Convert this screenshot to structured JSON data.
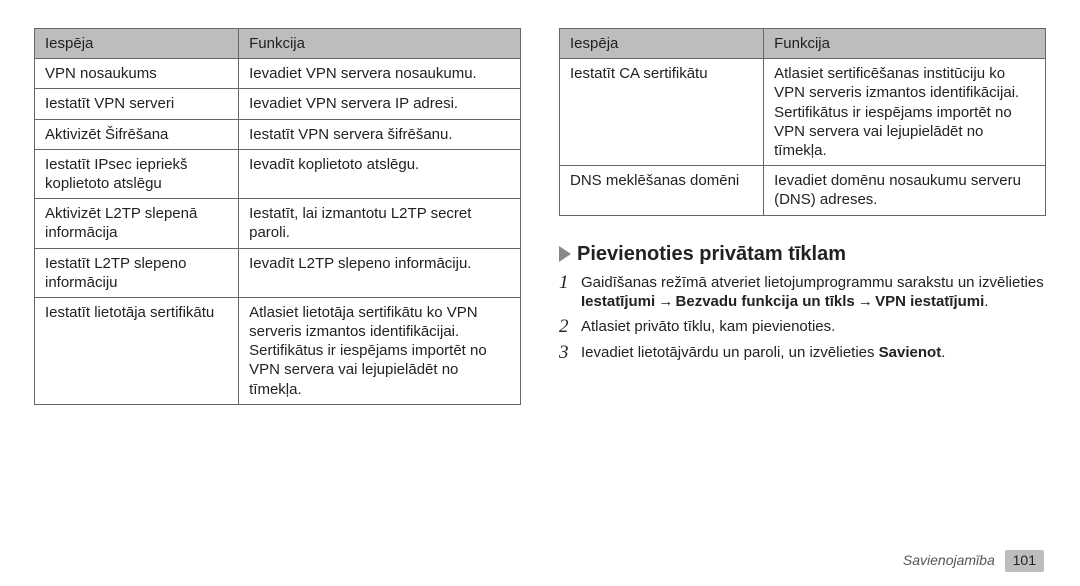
{
  "left_table": {
    "h1": "Iespēja",
    "h2": "Funkcija",
    "rows": [
      {
        "c1": "VPN nosaukums",
        "c2": "Ievadiet VPN servera nosaukumu."
      },
      {
        "c1": "Iestatīt VPN serveri",
        "c2": "Ievadiet VPN servera IP adresi."
      },
      {
        "c1": "Aktivizēt Šifrēšana",
        "c2": "Iestatīt VPN servera šifrēšanu."
      },
      {
        "c1": "Iestatīt IPsec iepriekš koplietoto atslēgu",
        "c2": "Ievadīt koplietoto atslēgu."
      },
      {
        "c1": "Aktivizēt L2TP slepenā informācija",
        "c2": "Iestatīt, lai izmantotu L2TP secret paroli."
      },
      {
        "c1": "Iestatīt L2TP slepeno informāciju",
        "c2": "Ievadīt L2TP slepeno informāciju."
      },
      {
        "c1": "Iestatīt lietotāja sertifikātu",
        "c2": "Atlasiet lietotāja sertifikātu ko VPN serveris izmantos identifikācijai. Sertifikātus ir iespējams importēt no VPN servera vai lejupielādēt no tīmekļa."
      }
    ]
  },
  "right_table": {
    "h1": "Iespēja",
    "h2": "Funkcija",
    "rows": [
      {
        "c1": "Iestatīt CA sertifikātu",
        "c2": "Atlasiet sertificēšanas institūciju ko VPN serveris izmantos identifikācijai. Sertifikātus ir iespējams importēt no VPN servera vai lejupielādēt no tīmekļa."
      },
      {
        "c1": "DNS meklēšanas domēni",
        "c2": "Ievadiet domēnu nosaukumu serveru (DNS) adreses."
      }
    ]
  },
  "section": {
    "title": "Pievienoties privātam tīklam",
    "steps": {
      "s1a": "Gaidīšanas režīmā atveriet lietojumprogrammu sarakstu un izvēlieties ",
      "s1b": "Iestatījumi",
      "s1arrow1": " → ",
      "s1c": "Bezvadu funkcija un tīkls",
      "s1arrow2": " → ",
      "s1d": "VPN iestatījumi",
      "s1e": ".",
      "s2": "Atlasiet privāto tīklu, kam pievienoties.",
      "s3a": "Ievadiet lietotājvārdu un paroli, un izvēlieties ",
      "s3b": "Savienot",
      "s3c": "."
    }
  },
  "footer": {
    "chapter": "Savienojamība",
    "page": "101"
  }
}
